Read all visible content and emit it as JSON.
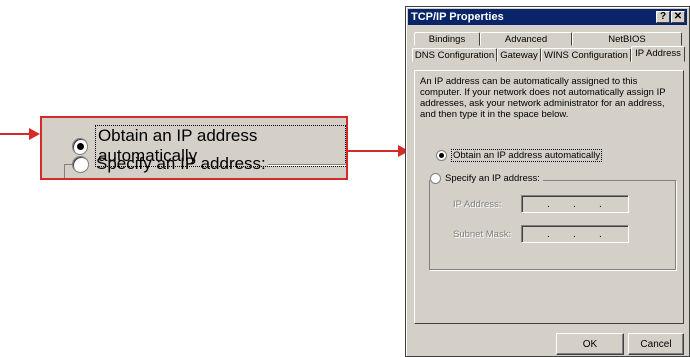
{
  "zoom": {
    "obtain_label": "Obtain an IP address automatically",
    "specify_label": "Specify an IP address:"
  },
  "dialog": {
    "title": "TCP/IP Properties",
    "help_label": "?",
    "close_label": "✕",
    "tabs_back": [
      "Bindings",
      "Advanced",
      "NetBIOS"
    ],
    "tabs_front": [
      "DNS Configuration",
      "Gateway",
      "WINS Configuration",
      "IP Address"
    ],
    "description": "An IP address can be automatically assigned to this computer. If your network does not automatically assign IP addresses, ask your network administrator for an address, and then type it in the space below.",
    "obtain_label": "Obtain an IP address automatically",
    "specify_label": "Specify an IP address:",
    "ip_label": "IP Address:",
    "mask_label": "Subnet Mask:",
    "ok_label": "OK",
    "cancel_label": "Cancel"
  },
  "colors": {
    "callout_red": "#d42a2a",
    "title_blue": "#0a246a",
    "window_gray": "#d4d0c8"
  }
}
